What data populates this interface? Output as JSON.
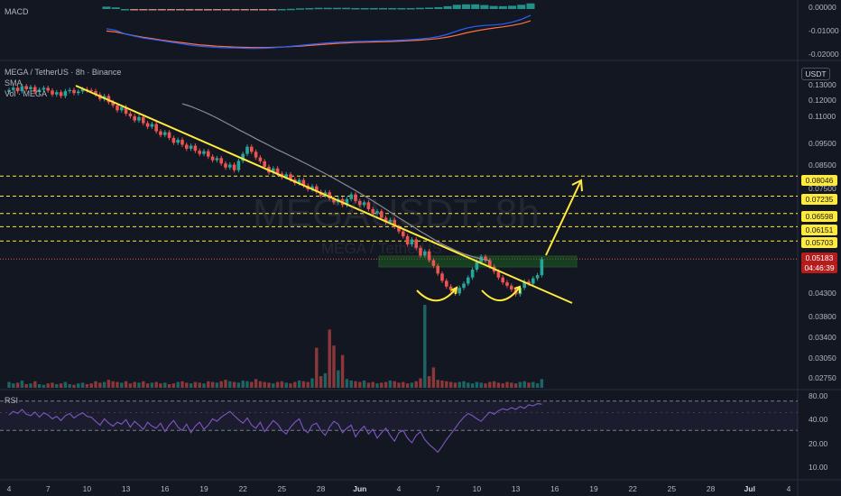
{
  "header": {
    "pair_title": "MEGA / TetherUS · 8h · Binance",
    "sma_label": "SMA",
    "vol_label": "Vol · MEGA",
    "macd_label": "MACD",
    "rsi_label": "RSI",
    "currency_button": "USDT"
  },
  "watermark": {
    "symbol": "MEGAUSDT, 8h",
    "name": "MEGA / TetherUS"
  },
  "price_tags": {
    "levels": [
      "0.08046",
      "0.07235",
      "0.06598",
      "0.06151",
      "0.05703"
    ],
    "current_price": "0.05183",
    "countdown": "04:46:39"
  },
  "colors": {
    "background": "#131722",
    "up": "#26a69a",
    "down": "#ef5350",
    "trendline": "#ffeb3b",
    "sma": "#9598a1",
    "zone": "#1b5e20",
    "rsi": "#7e57c2"
  },
  "chart_data": [
    {
      "type": "line",
      "name": "MACD",
      "y_tick_labels": [
        "0.00000",
        "-0.01000",
        "-0.02000"
      ],
      "y_ticks": [
        0.0,
        -0.01,
        -0.02
      ],
      "ylim": [
        -0.0205,
        0.002
      ],
      "macd": [
        -0.0088,
        -0.0095,
        -0.011,
        -0.012,
        -0.0128,
        -0.0134,
        -0.014,
        -0.0146,
        -0.0152,
        -0.0158,
        -0.0163,
        -0.0166,
        -0.0168,
        -0.017,
        -0.0171,
        -0.0172,
        -0.0173,
        -0.0172,
        -0.017,
        -0.0167,
        -0.0164,
        -0.016,
        -0.0156,
        -0.0152,
        -0.0149,
        -0.0146,
        -0.0144,
        -0.0143,
        -0.0142,
        -0.0141,
        -0.014,
        -0.0139,
        -0.0137,
        -0.0135,
        -0.0132,
        -0.0128,
        -0.0122,
        -0.0112,
        -0.0098,
        -0.0086,
        -0.0078,
        -0.0074,
        -0.0072,
        -0.0068,
        -0.006,
        -0.0048,
        -0.003
      ],
      "signal": [
        -0.0098,
        -0.0102,
        -0.011,
        -0.0118,
        -0.0125,
        -0.0131,
        -0.0137,
        -0.0142,
        -0.0147,
        -0.0152,
        -0.0157,
        -0.016,
        -0.0163,
        -0.0165,
        -0.0167,
        -0.0168,
        -0.0169,
        -0.0169,
        -0.0168,
        -0.0167,
        -0.0165,
        -0.0163,
        -0.016,
        -0.0157,
        -0.0154,
        -0.0151,
        -0.0149,
        -0.0147,
        -0.0146,
        -0.0145,
        -0.0144,
        -0.0143,
        -0.0141,
        -0.0139,
        -0.0137,
        -0.0134,
        -0.013,
        -0.0124,
        -0.0116,
        -0.0106,
        -0.0098,
        -0.0091,
        -0.0085,
        -0.008,
        -0.0074,
        -0.0066,
        -0.0054
      ]
    },
    {
      "type": "candlestick",
      "name": "MEGA / TetherUS · 8h",
      "y_tick_labels": [
        "0.13000",
        "0.12000",
        "0.11000",
        "0.09500",
        "0.08500",
        "0.07500",
        "0.05000",
        "0.04300",
        "0.03800",
        "0.03400",
        "0.03050",
        "0.02750"
      ],
      "y_ticks": [
        0.13,
        0.12,
        0.11,
        0.095,
        0.085,
        0.075,
        0.05,
        0.043,
        0.038,
        0.034,
        0.0305,
        0.0275
      ],
      "ylim": [
        0.0262,
        0.145
      ],
      "scale": "log",
      "x_tick_labels": [
        "4",
        "7",
        "10",
        "13",
        "16",
        "19",
        "22",
        "25",
        "28",
        "Jun",
        "4",
        "7",
        "10",
        "13",
        "16",
        "19",
        "22",
        "25",
        "28",
        "Jul",
        "4"
      ],
      "x_ticks": [
        0,
        9,
        18,
        27,
        36,
        45,
        54,
        63,
        72,
        81,
        90,
        99,
        108,
        117,
        126,
        135,
        144,
        153,
        162,
        171,
        180
      ],
      "x_bold": [
        "Jun",
        "Jul"
      ],
      "closes": [
        0.127,
        0.1285,
        0.1262,
        0.1296,
        0.1275,
        0.129,
        0.1258,
        0.1272,
        0.1284,
        0.1266,
        0.124,
        0.1255,
        0.123,
        0.1262,
        0.127,
        0.1249,
        0.126,
        0.1275,
        0.1268,
        0.1262,
        0.124,
        0.121,
        0.123,
        0.119,
        0.117,
        0.114,
        0.116,
        0.112,
        0.1105,
        0.108,
        0.11,
        0.1065,
        0.1045,
        0.106,
        0.102,
        0.1,
        0.1015,
        0.0985,
        0.096,
        0.0975,
        0.095,
        0.093,
        0.0945,
        0.092,
        0.0905,
        0.0918,
        0.0892,
        0.0875,
        0.0885,
        0.086,
        0.0842,
        0.0855,
        0.083,
        0.0872,
        0.0905,
        0.094,
        0.0915,
        0.0888,
        0.087,
        0.0845,
        0.082,
        0.0838,
        0.0815,
        0.08,
        0.0812,
        0.079,
        0.0775,
        0.0788,
        0.0765,
        0.075,
        0.0762,
        0.074,
        0.0726,
        0.0738,
        0.0715,
        0.07,
        0.0712,
        0.069,
        0.0712,
        0.073,
        0.0705,
        0.069,
        0.07,
        0.0675,
        0.066,
        0.0668,
        0.0645,
        0.063,
        0.0638,
        0.0615,
        0.06,
        0.0585,
        0.056,
        0.0575,
        0.055,
        0.0528,
        0.054,
        0.0515,
        0.05,
        0.048,
        0.0462,
        0.0448,
        0.044,
        0.0432,
        0.0445,
        0.0455,
        0.047,
        0.049,
        0.051,
        0.0525,
        0.0515,
        0.0498,
        0.0485,
        0.047,
        0.0458,
        0.045,
        0.0441,
        0.043,
        0.0445,
        0.046,
        0.0455,
        0.0468,
        0.0476,
        0.0518
      ],
      "sma": [
        0.118,
        0.1172,
        0.1163,
        0.1153,
        0.1142,
        0.1131,
        0.1119,
        0.1107,
        0.1094,
        0.1081,
        0.1068,
        0.1055,
        0.1042,
        0.1029,
        0.1017,
        0.1005,
        0.0993,
        0.0981,
        0.0969,
        0.0958,
        0.0947,
        0.0936,
        0.0925,
        0.0915,
        0.0905,
        0.0895,
        0.0885,
        0.0875,
        0.0865,
        0.0855,
        0.0845,
        0.0835,
        0.0825,
        0.0815,
        0.0805,
        0.0795,
        0.0785,
        0.0775,
        0.0765,
        0.0755,
        0.0745,
        0.0735,
        0.0725,
        0.0715,
        0.0705,
        0.0695,
        0.0685,
        0.0675,
        0.0665,
        0.0655,
        0.0645,
        0.0636,
        0.0627,
        0.0618,
        0.0609,
        0.06,
        0.0592,
        0.0584,
        0.0576,
        0.0568,
        0.0561,
        0.0555,
        0.0549,
        0.0543,
        0.0538,
        0.0533,
        0.0529,
        0.0525,
        0.0522,
        0.0519,
        0.0516,
        0.0514
      ],
      "levels": [
        0.08046,
        0.07235,
        0.06598,
        0.06151,
        0.05703
      ],
      "current_price": 0.05183,
      "volume": [
        0.8,
        0.6,
        0.7,
        1.0,
        0.5,
        0.6,
        0.9,
        0.5,
        0.4,
        0.6,
        0.7,
        0.5,
        0.6,
        0.8,
        0.5,
        0.4,
        0.6,
        0.7,
        0.5,
        0.6,
        0.9,
        0.7,
        0.8,
        1.1,
        0.9,
        0.8,
        0.7,
        0.9,
        0.6,
        0.8,
        0.7,
        0.9,
        0.6,
        0.7,
        0.8,
        0.6,
        0.7,
        0.5,
        0.6,
        0.8,
        0.9,
        0.7,
        0.6,
        0.8,
        0.7,
        0.6,
        0.9,
        0.8,
        0.7,
        0.9,
        1.1,
        0.9,
        0.8,
        0.7,
        1.0,
        0.9,
        0.8,
        1.2,
        0.9,
        0.8,
        0.7,
        0.6,
        0.8,
        0.9,
        0.7,
        0.6,
        0.8,
        1.0,
        0.9,
        0.8,
        1.3,
        5.5,
        1.6,
        2.0,
        8.0,
        5.8,
        2.4,
        4.5,
        1.2,
        1.0,
        0.9,
        0.8,
        1.0,
        0.7,
        0.8,
        0.6,
        0.7,
        0.8,
        1.0,
        0.9,
        0.7,
        0.8,
        0.6,
        0.7,
        0.9,
        1.3,
        11.4,
        1.6,
        2.8,
        1.1,
        1.0,
        0.9,
        0.8,
        0.7,
        0.8,
        0.9,
        0.7,
        0.6,
        0.8,
        0.7,
        0.6,
        0.8,
        0.9,
        0.7,
        0.6,
        0.8,
        0.7,
        0.6,
        0.8,
        0.9,
        0.7,
        0.8,
        0.6,
        1.2
      ]
    },
    {
      "type": "line",
      "name": "RSI",
      "y_tick_labels": [
        "80.00",
        "40.00",
        "20.00",
        "10.00"
      ],
      "y_ticks": [
        80,
        40,
        20,
        10
      ],
      "bands": [
        30,
        70
      ],
      "ylim": [
        8,
        88
      ],
      "scale": "log",
      "values": [
        47,
        52,
        49,
        55,
        48,
        46,
        51,
        44,
        50,
        47,
        42,
        45,
        40,
        46,
        49,
        43,
        47,
        50,
        45,
        44,
        39,
        35,
        42,
        37,
        34,
        38,
        36,
        41,
        33,
        39,
        35,
        31,
        38,
        34,
        32,
        37,
        29,
        35,
        40,
        33,
        30,
        36,
        28,
        34,
        38,
        31,
        35,
        42,
        39,
        44,
        48,
        52,
        46,
        41,
        37,
        43,
        35,
        32,
        38,
        29,
        34,
        40,
        36,
        30,
        27,
        33,
        38,
        42,
        31,
        28,
        35,
        37,
        30,
        26,
        33,
        39,
        36,
        28,
        32,
        35,
        25,
        30,
        34,
        27,
        31,
        24,
        28,
        32,
        26,
        22,
        28,
        30,
        24,
        21,
        26,
        29,
        23,
        20,
        18,
        16,
        19,
        23,
        27,
        32,
        38,
        44,
        49,
        46,
        42,
        39,
        45,
        51,
        48,
        53,
        56,
        54,
        58,
        55,
        60,
        57,
        63,
        61,
        65,
        64
      ]
    }
  ]
}
